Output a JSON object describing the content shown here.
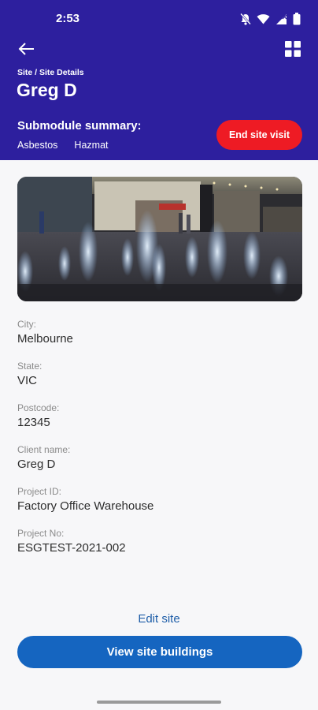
{
  "status_bar": {
    "time": "2:53",
    "icons": [
      "mute-icon",
      "wifi-icon",
      "signal-icon",
      "battery-icon"
    ]
  },
  "header": {
    "breadcrumb": "Site / Site Details",
    "title": "Greg D",
    "summary_title": "Submodule summary:",
    "submodules": [
      "Asbestos",
      "Hazmat"
    ],
    "end_visit_label": "End site visit",
    "back_icon": "arrow-left-icon",
    "menu_icon": "grid-icon"
  },
  "details": {
    "city": {
      "label": "City:",
      "value": "Melbourne"
    },
    "state": {
      "label": "State:",
      "value": "VIC"
    },
    "postcode": {
      "label": "Postcode:",
      "value": "12345"
    },
    "client_name": {
      "label": "Client name:",
      "value": "Greg D"
    },
    "project_id": {
      "label": "Project ID:",
      "value": "Factory Office Warehouse"
    },
    "project_no": {
      "label": "Project No:",
      "value": "ESGTEST-2021-002"
    }
  },
  "actions": {
    "edit_site": "Edit site",
    "view_buildings": "View site buildings"
  },
  "colors": {
    "header_bg": "#2d1f9e",
    "end_visit_bg": "#ee1b24",
    "primary_button_bg": "#1565c0",
    "link": "#1f5ea8",
    "page_bg": "#f7f7f9"
  }
}
